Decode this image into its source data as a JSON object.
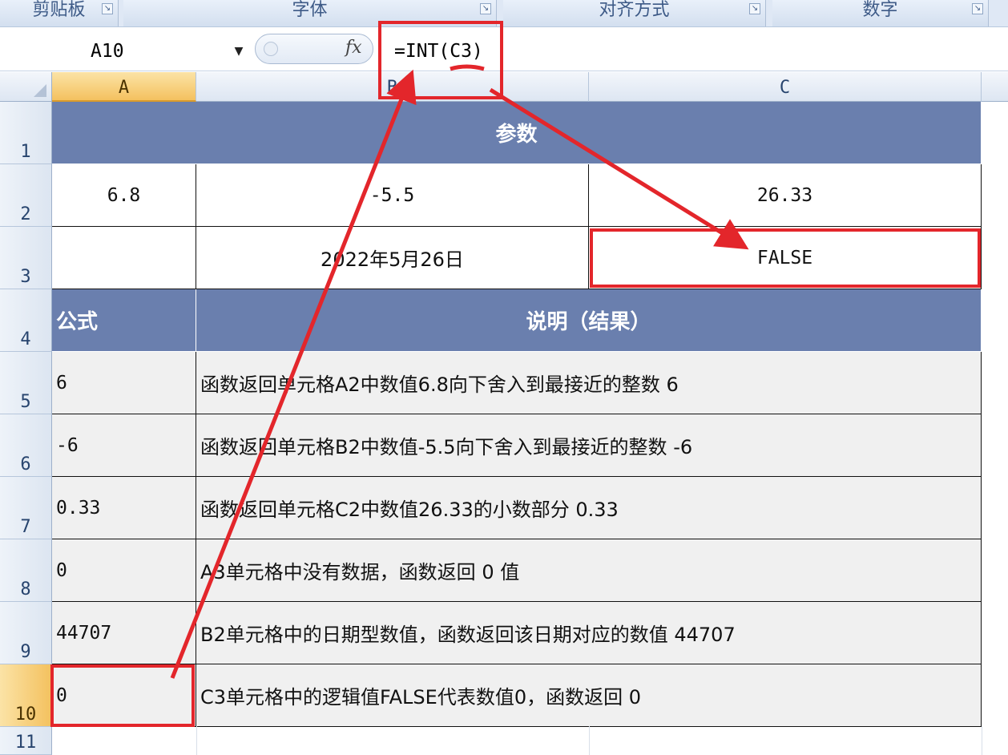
{
  "ribbon": {
    "groups": [
      "剪贴板",
      "字体",
      "对齐方式",
      "数字"
    ]
  },
  "formula_bar": {
    "name_box": "A10",
    "fx_icon": "fx-function-icon",
    "formula": "=INT(C3)"
  },
  "columns": [
    "A",
    "B",
    "C"
  ],
  "rows": [
    "1",
    "2",
    "3",
    "4",
    "5",
    "6",
    "7",
    "8",
    "9",
    "10",
    "11"
  ],
  "table": {
    "params_header": "参数",
    "r2": [
      "6.8",
      "-5.5",
      "26.33"
    ],
    "r3": [
      "",
      "2022年5月26日",
      "FALSE"
    ],
    "formula_header": "公式",
    "desc_header": "说明（结果）",
    "body": [
      {
        "formula": "6",
        "desc": "函数返回单元格A2中数值6.8向下舍入到最接近的整数 6"
      },
      {
        "formula": "-6",
        "desc": "函数返回单元格B2中数值-5.5向下舍入到最接近的整数 -6"
      },
      {
        "formula": "0.33",
        "desc": "函数返回单元格C2中数值26.33的小数部分 0.33"
      },
      {
        "formula": "0",
        "desc": "A3单元格中没有数据，函数返回 0 值"
      },
      {
        "formula": "44707",
        "desc": "B2单元格中的日期型数值，函数返回该日期对应的数值 44707"
      },
      {
        "formula": "0",
        "desc": "C3单元格中的逻辑值FALSE代表数值0，函数返回 0"
      }
    ]
  },
  "colors": {
    "header_fill": "#6a7fae",
    "annotation_red": "#e3262b",
    "active_header": "#f4c15f"
  }
}
